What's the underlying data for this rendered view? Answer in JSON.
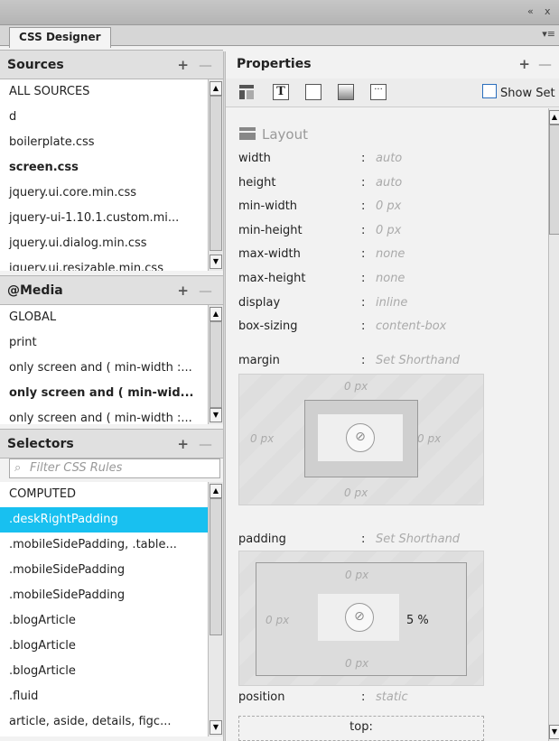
{
  "window": {
    "collapse_glyph": "«",
    "close_glyph": "x"
  },
  "panel_tab": {
    "label": "CSS Designer",
    "menu_glyph": "▾≡"
  },
  "sources": {
    "header": "Sources",
    "add_glyph": "+",
    "remove_glyph": "—",
    "items": [
      {
        "label": "ALL SOURCES",
        "bold": false
      },
      {
        "label": "d",
        "bold": false
      },
      {
        "label": "boilerplate.css",
        "bold": false
      },
      {
        "label": "screen.css",
        "bold": true
      },
      {
        "label": "jquery.ui.core.min.css",
        "bold": false
      },
      {
        "label": "jquery-ui-1.10.1.custom.mi...",
        "bold": false
      },
      {
        "label": "jquery.ui.dialog.min.css",
        "bold": false
      },
      {
        "label": "jquery.ui.resizable.min.css",
        "bold": false
      }
    ]
  },
  "media": {
    "header": "@Media",
    "add_glyph": "+",
    "remove_glyph": "—",
    "items": [
      {
        "label": "GLOBAL",
        "bold": false
      },
      {
        "label": "print",
        "bold": false
      },
      {
        "label": "only screen and ( min-width :...",
        "bold": false
      },
      {
        "label": "only screen and ( min-wid...",
        "bold": true
      },
      {
        "label": "only screen and ( min-width :...",
        "bold": false
      }
    ]
  },
  "selectors": {
    "header": "Selectors",
    "add_glyph": "+",
    "remove_glyph": "—",
    "filter_placeholder": "Filter CSS Rules",
    "items": [
      {
        "label": "COMPUTED",
        "selected": false
      },
      {
        "label": ".deskRightPadding",
        "selected": true
      },
      {
        "label": ".mobileSidePadding, .table...",
        "selected": false
      },
      {
        "label": ".mobileSidePadding",
        "selected": false
      },
      {
        "label": ".mobileSidePadding",
        "selected": false
      },
      {
        "label": ".blogArticle",
        "selected": false
      },
      {
        "label": ".blogArticle",
        "selected": false
      },
      {
        "label": ".blogArticle",
        "selected": false
      },
      {
        "label": ".fluid",
        "selected": false
      },
      {
        "label": "article, aside, details, figc...",
        "selected": false
      }
    ]
  },
  "properties": {
    "header": "Properties",
    "add_glyph": "+",
    "remove_glyph": "—",
    "toolbar_icons": [
      "layout-icon",
      "text-icon",
      "border-icon",
      "background-icon",
      "more-icon"
    ],
    "show_set_label": "Show Set",
    "show_set_checked": false,
    "layout_label": "Layout",
    "layout_rows": [
      {
        "key": "width",
        "value": "auto"
      },
      {
        "key": "height",
        "value": "auto"
      },
      {
        "key": "min-width",
        "value": "0 px"
      },
      {
        "key": "min-height",
        "value": "0 px"
      },
      {
        "key": "max-width",
        "value": "none"
      },
      {
        "key": "max-height",
        "value": "none"
      },
      {
        "key": "display",
        "value": "inline"
      },
      {
        "key": "box-sizing",
        "value": "content-box"
      }
    ],
    "separator": ":",
    "margin": {
      "key": "margin",
      "value": "Set Shorthand",
      "top": "0 px",
      "right": "0 px",
      "bottom": "0 px",
      "left": "0 px"
    },
    "padding": {
      "key": "padding",
      "value": "Set Shorthand",
      "top": "0 px",
      "right": "5 %",
      "bottom": "0 px",
      "left": "0 px"
    },
    "position": {
      "key": "position",
      "value": "static"
    },
    "position_top_label": "top:"
  }
}
